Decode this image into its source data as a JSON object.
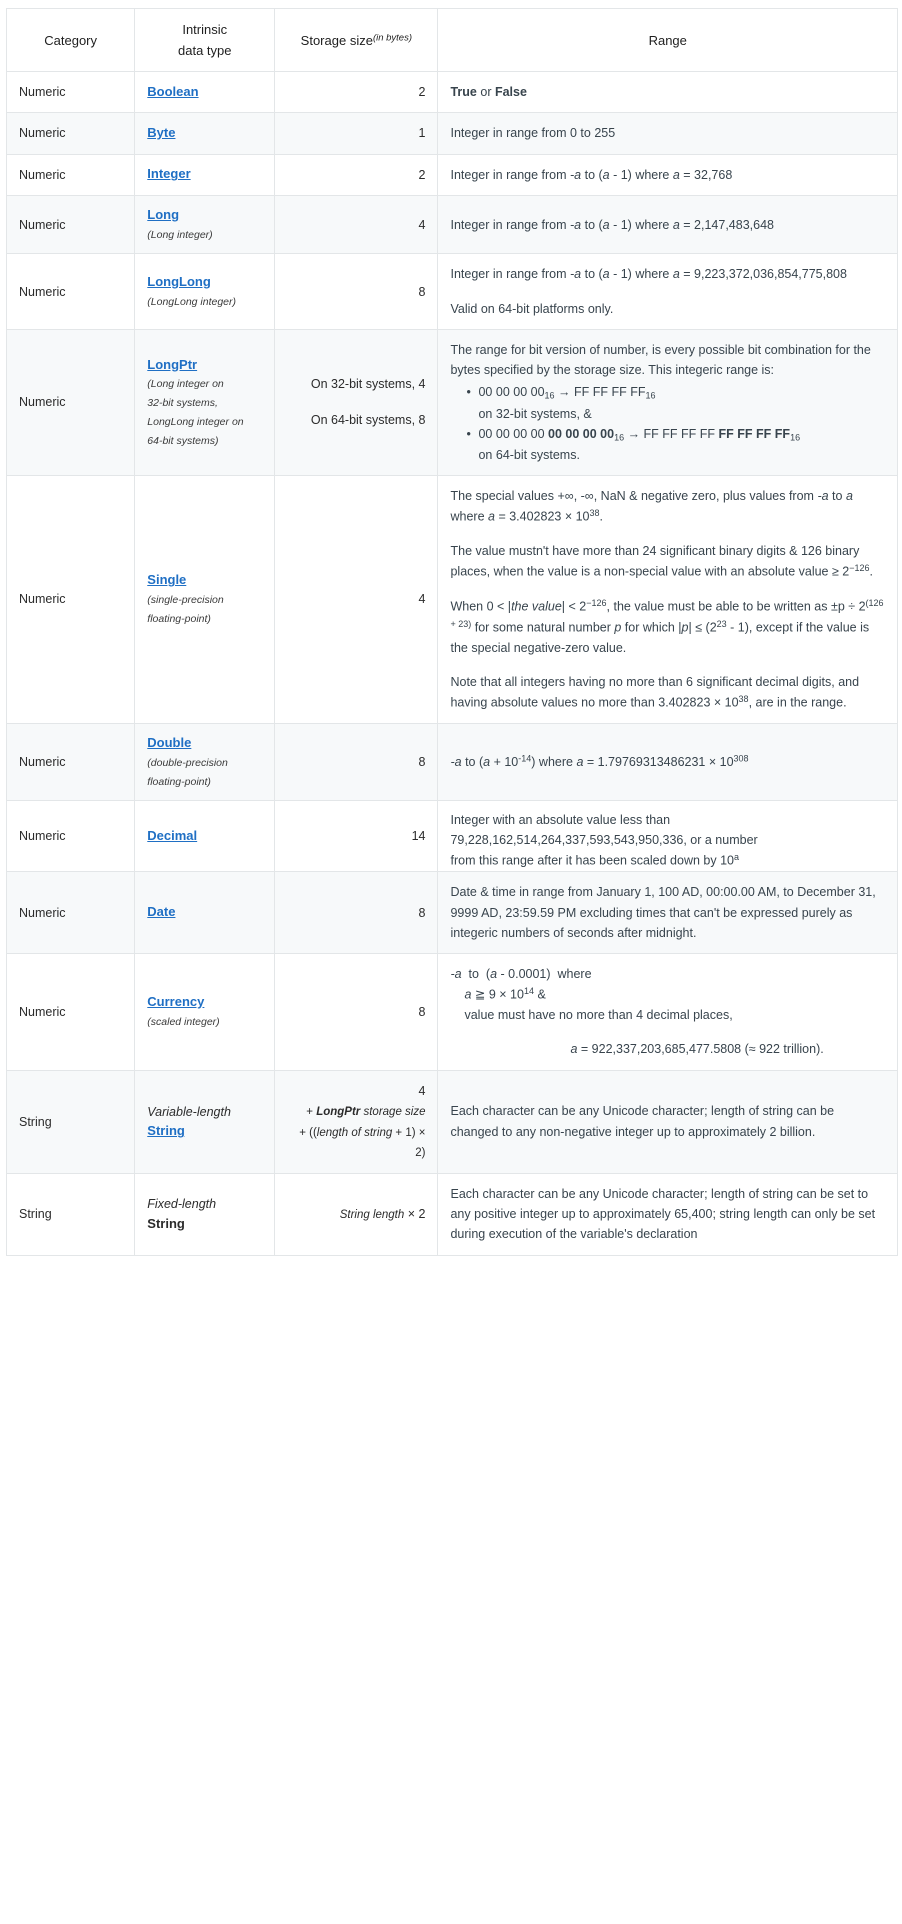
{
  "table": {
    "headers": {
      "category": "Category",
      "type_line1": "Intrinsic",
      "type_line2": "data type",
      "size_main": "Storage size",
      "size_sup": "(in bytes)",
      "range": "Range"
    },
    "rows": [
      {
        "category": "Numeric",
        "type": "Boolean",
        "subtype": "",
        "size": "2",
        "range_plain": "True or False"
      },
      {
        "category": "Numeric",
        "type": "Byte",
        "subtype": "",
        "size": "1",
        "range_plain": "Integer in range from 0 to 255"
      },
      {
        "category": "Numeric",
        "type": "Integer",
        "subtype": "",
        "size": "2",
        "range_plain": "Integer in range from -a to (a - 1) where a = 32,768"
      },
      {
        "category": "Numeric",
        "type": "Long",
        "subtype": "(Long integer)",
        "size": "4",
        "range_plain": "Integer in range from -a to (a - 1) where a = 2,147,483,648"
      },
      {
        "category": "Numeric",
        "type": "LongLong",
        "subtype": "(LongLong integer)",
        "size": "8",
        "range_line1": "Integer in range from -a to (a - 1) where a = 9,223,372,036,854,775,808",
        "range_line2": "Valid on 64-bit platforms only."
      },
      {
        "category": "Numeric",
        "type": "LongPtr",
        "subtype_line1": "(Long integer on",
        "subtype_line2": "32-bit systems,",
        "subtype_line3": "LongLong integer on",
        "subtype_line4": "64-bit systems)",
        "size_line1": "On 32-bit systems, 4",
        "size_line2": "On 64-bit systems, 8",
        "range_intro": "The range for bit version of number, is every possible bit combination for the bytes specified by the storage size. This integeric range is:",
        "bullet1_lead": "00 00 00 00",
        "bullet1_sub": "16",
        "bullet1_arrow": "→",
        "bullet1_tail": "FF FF FF FF",
        "bullet1_tail_sub": "16",
        "bullet1_note": "on 32-bit systems, &",
        "bullet2_lead_normal": "00 00 00 00",
        "bullet2_lead_bold": "00 00 00 00",
        "bullet2_sub": "16",
        "bullet2_arrow": "→",
        "bullet2_tail_normal": "FF FF FF FF",
        "bullet2_tail_bold": "FF FF FF FF",
        "bullet2_tail_sub": "16",
        "bullet2_note": "on 64-bit systems."
      },
      {
        "category": "Numeric",
        "type": "Single",
        "subtype_line1": "(single-precision",
        "subtype_line2": "floating-point)",
        "size": "4",
        "para1_a": "The special values +∞, -∞, NaN & negative zero, plus values from -",
        "para1_b": " to ",
        "para1_c": " where ",
        "para1_d": " = 3.402823 × 10",
        "para1_exp": "38",
        "para1_end": ".",
        "para2_a": "The value mustn't have more than 24 significant binary digits & 126 binary places, when the value is a non-special value with an absolute value ≥ 2",
        "para2_exp": "−126",
        "para2_end": ".",
        "para3_a": "When 0 < |",
        "para3_italic1": "the value",
        "para3_b": "| < 2",
        "para3_exp1": "−126",
        "para3_c": ", the value must be able to be written as ±p ÷ 2",
        "para3_exp2": "(126 + 23)",
        "para3_d": " for some natural number ",
        "para3_italic2": "p",
        "para3_e": " for which |",
        "para3_italic3": "p",
        "para3_f": "| ≤ (2",
        "para3_exp3": "23",
        "para3_g": " - 1), except if the value is the special negative-zero value.",
        "para4_a": "Note that all integers having no more than 6 significant decimal digits, and having absolute values no more than 3.402823 × 10",
        "para4_exp": "38",
        "para4_end": ", are in the range."
      },
      {
        "category": "Numeric",
        "type": "Double",
        "subtype_line1": "(double-precision",
        "subtype_line2": "floating-point)",
        "size": "8",
        "range_a": "-",
        "range_b": " to (",
        "range_c": " + 10",
        "range_exp1": "-14",
        "range_d": ") where ",
        "range_e": " = 1.79769313486231 × 10",
        "range_exp2": "308"
      },
      {
        "category": "Numeric",
        "type": "Decimal",
        "subtype": "",
        "size": "14",
        "range_line1": "Integer with an absolute value less than",
        "range_line2": "79,228,162,514,264,337,593,543,950,336, or a number",
        "range_line3_a": "from this range after it has been scaled down by 10",
        "range_line3_sup": "a"
      },
      {
        "category": "Numeric",
        "type": "Date",
        "subtype": "",
        "size": "8",
        "range_plain": "Date & time in range from  January 1, 100 AD, 00:00.00 AM,  to  December 31, 9999 AD, 23:59.59 PM  excluding times that can't be expressed purely as integeric numbers of seconds after midnight."
      },
      {
        "category": "Numeric",
        "type": "Currency",
        "subtype": "(scaled integer)",
        "size": "8",
        "line1_a": "-",
        "line1_b": "  to  (",
        "line1_c": " - 0.0001)  where",
        "line2_a": " ≧ 9 × 10",
        "line2_exp": "14",
        "line2_b": " &",
        "line3": "value must have no more than 4 decimal places,",
        "line4_a": " = 922,337,203,685,477.5808 (≈ 922 trillion)."
      },
      {
        "category": "String",
        "type_italic": "Variable-length",
        "type_bold": "String",
        "size_line1": "4",
        "size_line2_plus": "+ ",
        "size_line2_bold": "LongPtr",
        "size_line2_rest": " storage size",
        "size_line3_a": "+ ((",
        "size_line3_italic": "length of string",
        "size_line3_b": " + 1) × 2)",
        "range_plain": "Each character can be any Unicode character; length of string can be changed to any non-negative integer up to approximately 2 billion."
      },
      {
        "category": "String",
        "type_italic": "Fixed-length",
        "type_bold": "String",
        "size_italic": "String length",
        "size_rest": " × 2",
        "range_plain": "Each character can be any Unicode character; length of string can be set to any positive integer up to approximately 65,400; string length can only be set during execution of the variable's declaration"
      }
    ]
  },
  "colors": {
    "link": "#1f6fc4",
    "border": "#e3e6e8",
    "alt_row": "#f7f9fa",
    "text": "#2b2b2b",
    "range_text": "#38444d"
  }
}
